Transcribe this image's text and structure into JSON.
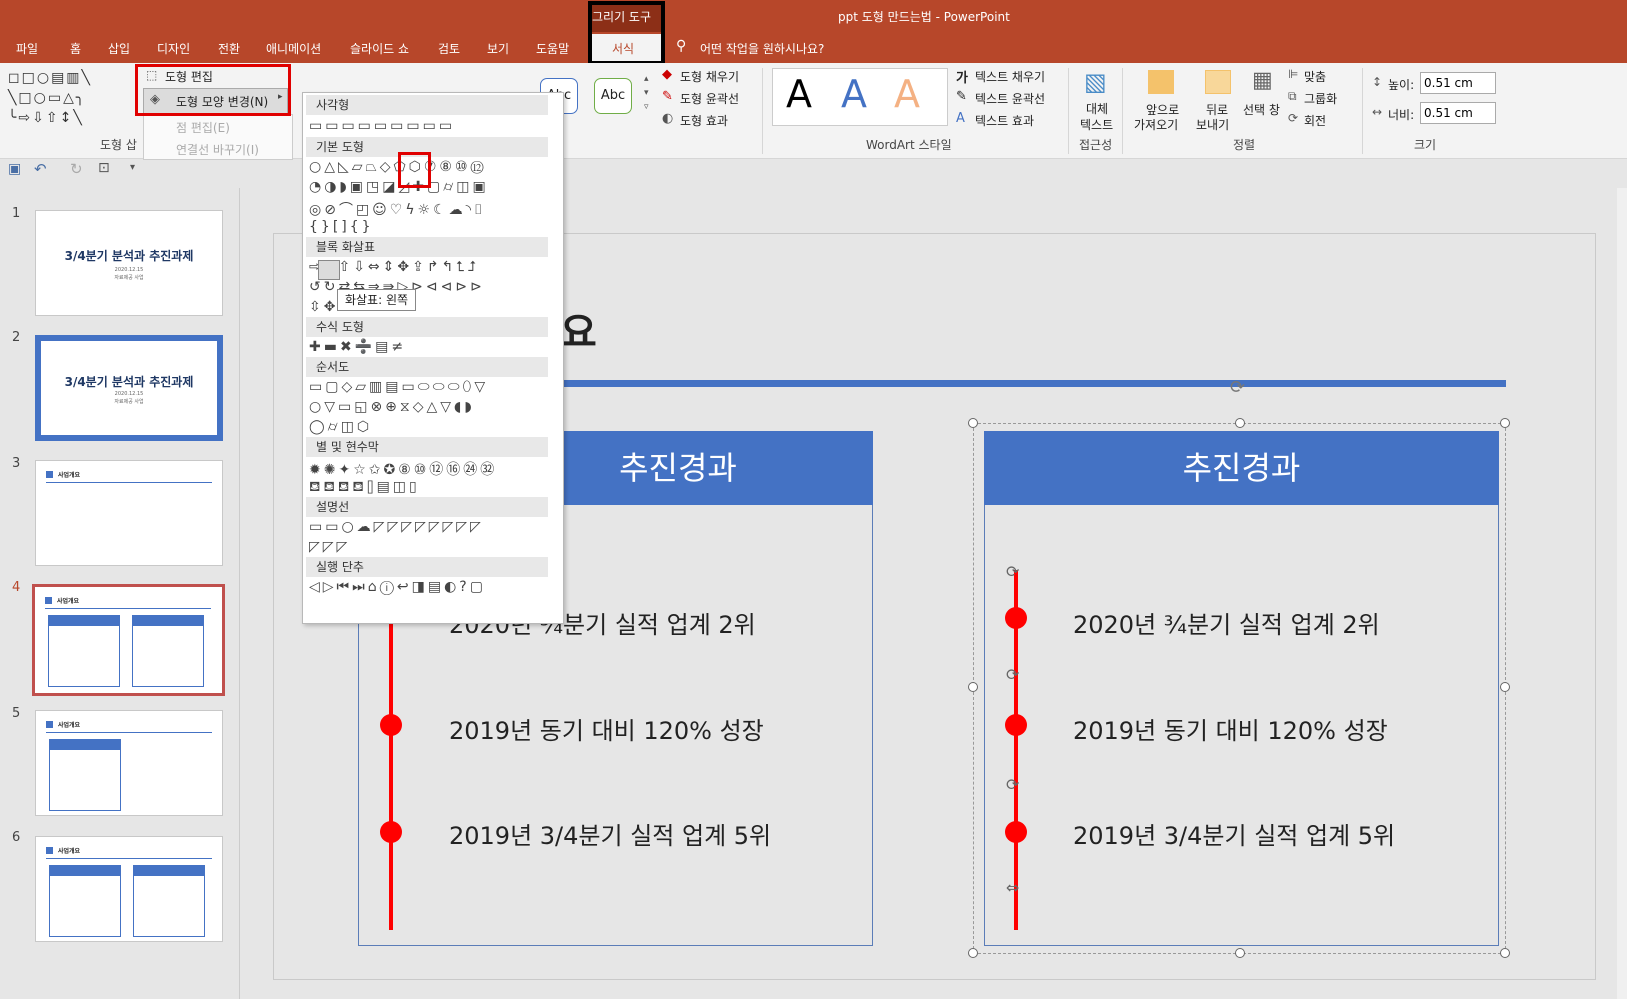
{
  "title_bar": {
    "context_tab": "그리기 도구",
    "document_title": "ppt 도형 만드는법  -  PowerPoint"
  },
  "tabs": [
    "파일",
    "홈",
    "삽입",
    "디자인",
    "전환",
    "애니메이션",
    "슬라이드 쇼",
    "검토",
    "보기",
    "도움말",
    "서식"
  ],
  "tell_me": "어떤 작업을 원하시나요?",
  "ribbon": {
    "edit_shape": "도형 편집",
    "change_shape": "도형 모양 변경(N)",
    "edit_points": "점 편집(E)",
    "reroute": "연결선 바꾸기(I)",
    "insert_group": "도형 삽",
    "style_abc": "Abc",
    "shape_fill": "도형 채우기",
    "shape_outline": "도형 윤곽선",
    "shape_effects": "도형 효과",
    "wordart_letter": "A",
    "wordart_group": "WordArt 스타일",
    "text_fill": "텍스트 채우기",
    "text_outline": "텍스트 윤곽선",
    "text_effects": "텍스트 효과",
    "alt_text_1": "대체",
    "alt_text_2": "텍스트",
    "accessibility_group": "접근성",
    "bring_forward_1": "앞으로",
    "bring_forward_2": "가져오기",
    "send_backward_1": "뒤로",
    "send_backward_2": "보내기",
    "selection_pane": "선택 창",
    "align": "맞춤",
    "group": "그룹화",
    "rotate": "회전",
    "arrange_group": "정렬",
    "height_label": "높이:",
    "height_value": "0.51 cm",
    "width_label": "너비:",
    "width_value": "0.51 cm",
    "size_group": "크기"
  },
  "dropdown": {
    "sections": [
      "사각형",
      "기본 도형",
      "블록 화살표",
      "수식 도형",
      "순서도",
      "별 및 현수막",
      "설명선",
      "실행 단추"
    ],
    "tooltip": "화살표: 왼쪽"
  },
  "thumbnails": [
    {
      "num": "1",
      "title": "3/4분기 분석과 추진과제",
      "sub1": "2020.12.15",
      "sub2": "자료제공 사업"
    },
    {
      "num": "2",
      "title": "3/4분기 분석과 추진과제",
      "sub1": "2020.12.15",
      "sub2": "자료제공 사업"
    },
    {
      "num": "3",
      "label": "사업개요"
    },
    {
      "num": "4",
      "label": "사업개요"
    },
    {
      "num": "5",
      "label": "사업개요"
    },
    {
      "num": "6",
      "label": "사업개요"
    }
  ],
  "slide": {
    "title_partial": "요",
    "card_title": "추진경과",
    "items": [
      "2020년 ¾분기 실적 업계 2위",
      "2019년 동기 대비 120% 성장",
      "2019년 3/4분기 실적 업계 5위"
    ],
    "left_item1_partial": "2020년 ¾분기 실적 업계 2위"
  },
  "colors": {
    "accent": "#b7472a",
    "card": "#4472c4",
    "timeline": "#ff0000",
    "highlight": "#e00000"
  }
}
